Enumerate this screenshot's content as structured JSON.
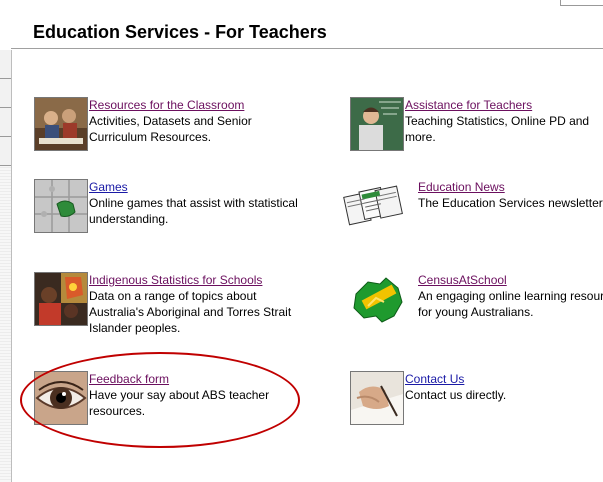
{
  "page": {
    "title": "Education Services - For Teachers"
  },
  "items": [
    {
      "title": "Resources for the Classroom",
      "desc": "Activities, Datasets and Senior Curriculum Resources.",
      "icon": "classroom-photo"
    },
    {
      "title": "Assistance for Teachers",
      "desc": "Teaching Statistics, Online PD and more.",
      "icon": "teacher-photo"
    },
    {
      "title": "Games",
      "desc": "Online games that assist with statistical understanding.",
      "icon": "puzzle-icon"
    },
    {
      "title": "Education News",
      "desc": "The Education Services newsletter.",
      "icon": "newsletter-icon"
    },
    {
      "title": "Indigenous Statistics for Schools",
      "desc": "Data on a range of topics about Australia's Aboriginal and Torres Strait Islander peoples.",
      "icon": "indigenous-photo"
    },
    {
      "title": "CensusAtSchool",
      "desc": "An engaging online learning resource for young Australians.",
      "icon": "censusatschool-icon"
    },
    {
      "title": "Feedback form",
      "desc": "Have your say about ABS teacher resources.",
      "icon": "eye-photo"
    },
    {
      "title": "Contact Us",
      "desc": "Contact us directly.",
      "icon": "writing-hand-photo"
    }
  ],
  "colors": {
    "visited_link": "#6b0f5e",
    "link": "#1a1aa6",
    "highlight_oval": "#c00000"
  }
}
